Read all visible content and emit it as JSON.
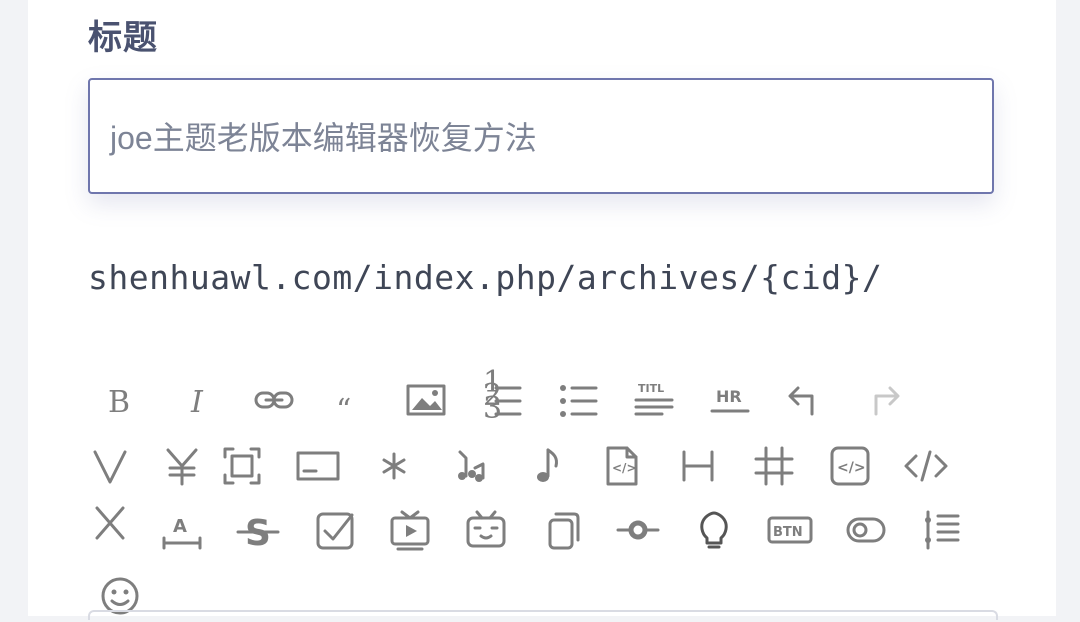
{
  "form": {
    "title_label": "标题",
    "title_value": "joe主题老版本编辑器恢复方法",
    "slug_text": "shenhuawl.com/index.php/archives/{cid}/"
  },
  "toolbar": {
    "items": [
      {
        "name": "bold",
        "glyph": "B"
      },
      {
        "name": "italic",
        "glyph": "I"
      },
      {
        "name": "link",
        "glyph": "link"
      },
      {
        "name": "quote",
        "glyph": "“"
      },
      {
        "name": "image",
        "glyph": "image"
      },
      {
        "name": "ordered-list",
        "glyph": "ol"
      },
      {
        "name": "unordered-list",
        "glyph": "ul"
      },
      {
        "name": "title",
        "glyph": "TITL"
      },
      {
        "name": "horizontal-rule",
        "glyph": "HR"
      },
      {
        "name": "undo",
        "glyph": "undo"
      },
      {
        "name": "redo",
        "glyph": "redo"
      },
      {
        "name": "v",
        "glyph": "V"
      },
      {
        "name": "currency",
        "glyph": "¥"
      },
      {
        "name": "fullscreen",
        "glyph": "fullscreen"
      },
      {
        "name": "card",
        "glyph": "card"
      },
      {
        "name": "asterisk",
        "glyph": "*"
      },
      {
        "name": "music-list",
        "glyph": "music-list"
      },
      {
        "name": "music",
        "glyph": "♪"
      },
      {
        "name": "code-file",
        "glyph": "code-file"
      },
      {
        "name": "heading",
        "glyph": "H"
      },
      {
        "name": "hash",
        "glyph": "#"
      },
      {
        "name": "code-block",
        "glyph": "code-block"
      },
      {
        "name": "code",
        "glyph": "</>"
      },
      {
        "name": "x",
        "glyph": "X"
      },
      {
        "name": "text-width",
        "glyph": "A"
      },
      {
        "name": "strikethrough",
        "glyph": "S"
      },
      {
        "name": "task",
        "glyph": "task"
      },
      {
        "name": "video",
        "glyph": "video"
      },
      {
        "name": "bilibili",
        "glyph": "bilibili"
      },
      {
        "name": "copy",
        "glyph": "copy"
      },
      {
        "name": "timeline-dot",
        "glyph": "timeline-dot"
      },
      {
        "name": "bulb",
        "glyph": "bulb"
      },
      {
        "name": "button",
        "glyph": "BTN"
      },
      {
        "name": "toggle",
        "glyph": "toggle"
      },
      {
        "name": "timeline-list",
        "glyph": "timeline-list"
      },
      {
        "name": "emoji",
        "glyph": "☺"
      }
    ]
  },
  "colors": {
    "input_border": "#6f76ad",
    "label": "#4a5270",
    "icon": "#7e7e7e"
  }
}
